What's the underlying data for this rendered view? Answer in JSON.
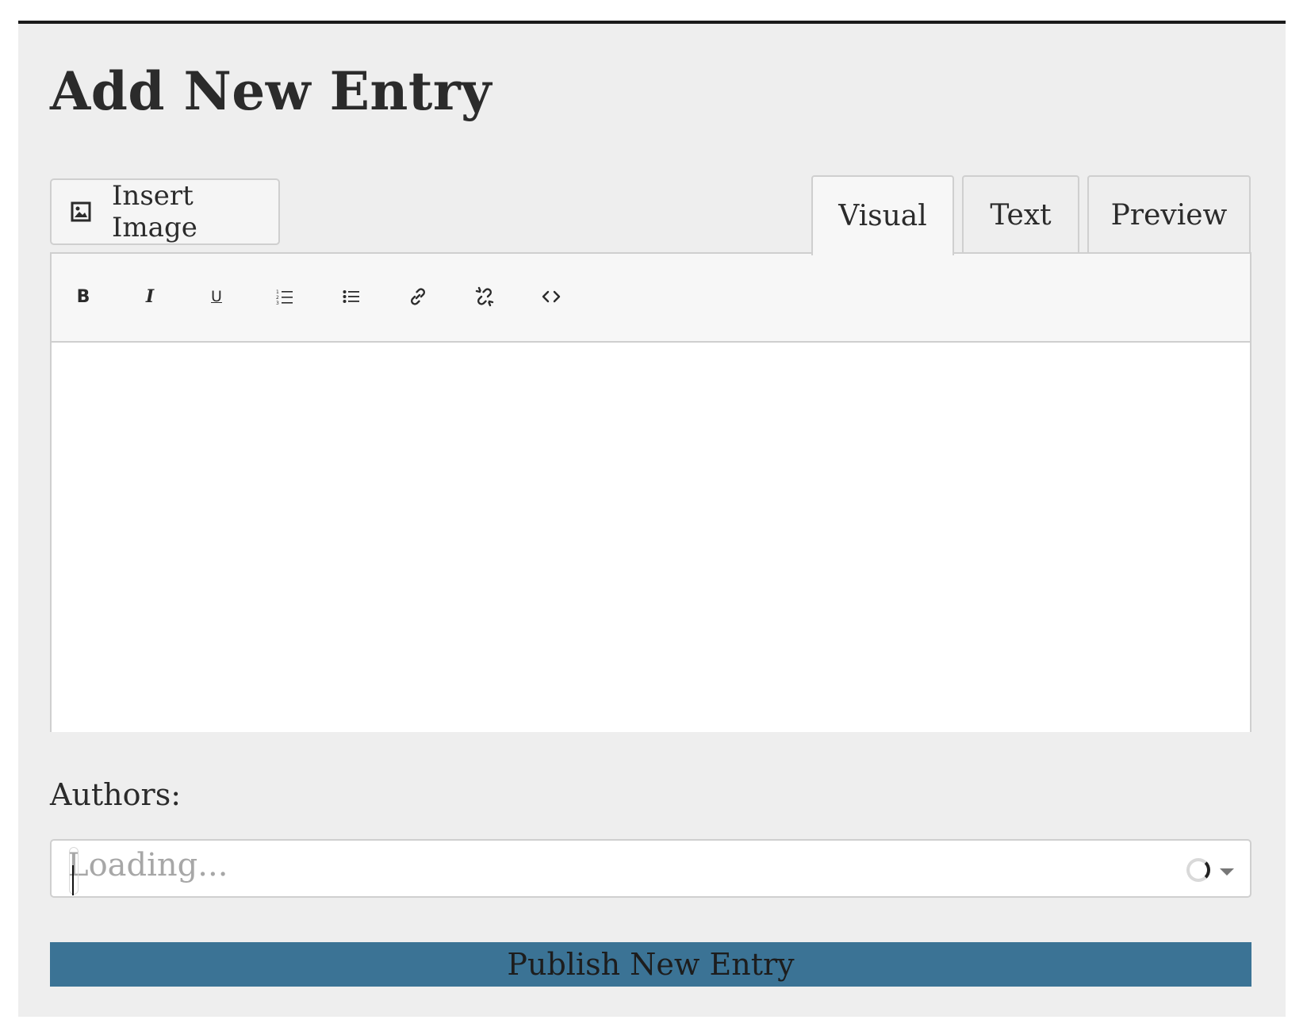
{
  "page": {
    "title": "Add New Entry"
  },
  "toolbar_top": {
    "insert_image_label": "Insert Image",
    "insert_image_icon": "image-icon"
  },
  "tabs": [
    {
      "label": "Visual",
      "active": true
    },
    {
      "label": "Text",
      "active": false
    },
    {
      "label": "Preview",
      "active": false
    }
  ],
  "editor": {
    "tools": [
      {
        "name": "bold",
        "icon": "bold-icon",
        "glyph": "B"
      },
      {
        "name": "italic",
        "icon": "italic-icon",
        "glyph": "I"
      },
      {
        "name": "underline",
        "icon": "underline-icon",
        "glyph": "U"
      },
      {
        "name": "ordered-list",
        "icon": "ordered-list-icon"
      },
      {
        "name": "unordered-list",
        "icon": "unordered-list-icon"
      },
      {
        "name": "link",
        "icon": "link-icon"
      },
      {
        "name": "unlink",
        "icon": "unlink-icon"
      },
      {
        "name": "code",
        "icon": "code-icon"
      }
    ],
    "content": ""
  },
  "authors": {
    "label": "Authors:",
    "placeholder": "Loading..."
  },
  "publish": {
    "label": "Publish New Entry"
  },
  "colors": {
    "panel_background": "#eeeeee",
    "publish_button": "#3b7395",
    "border": "#cfcfcf",
    "text": "#2b2b2b"
  }
}
